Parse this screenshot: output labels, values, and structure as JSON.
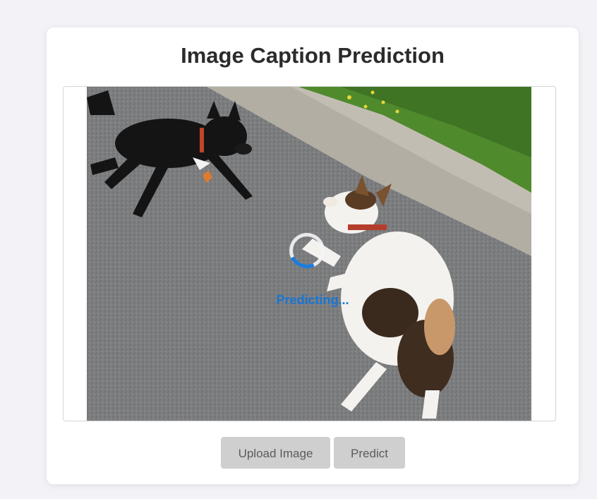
{
  "page": {
    "title": "Image Caption Prediction"
  },
  "preview": {
    "status_text": "Predicting...",
    "image_alt": "two dogs playing on a road"
  },
  "buttons": {
    "upload_label": "Upload Image",
    "predict_label": "Predict"
  },
  "colors": {
    "background": "#f3f3f7",
    "card": "#ffffff",
    "button": "#cfcfcf",
    "accent": "#1976d2"
  }
}
